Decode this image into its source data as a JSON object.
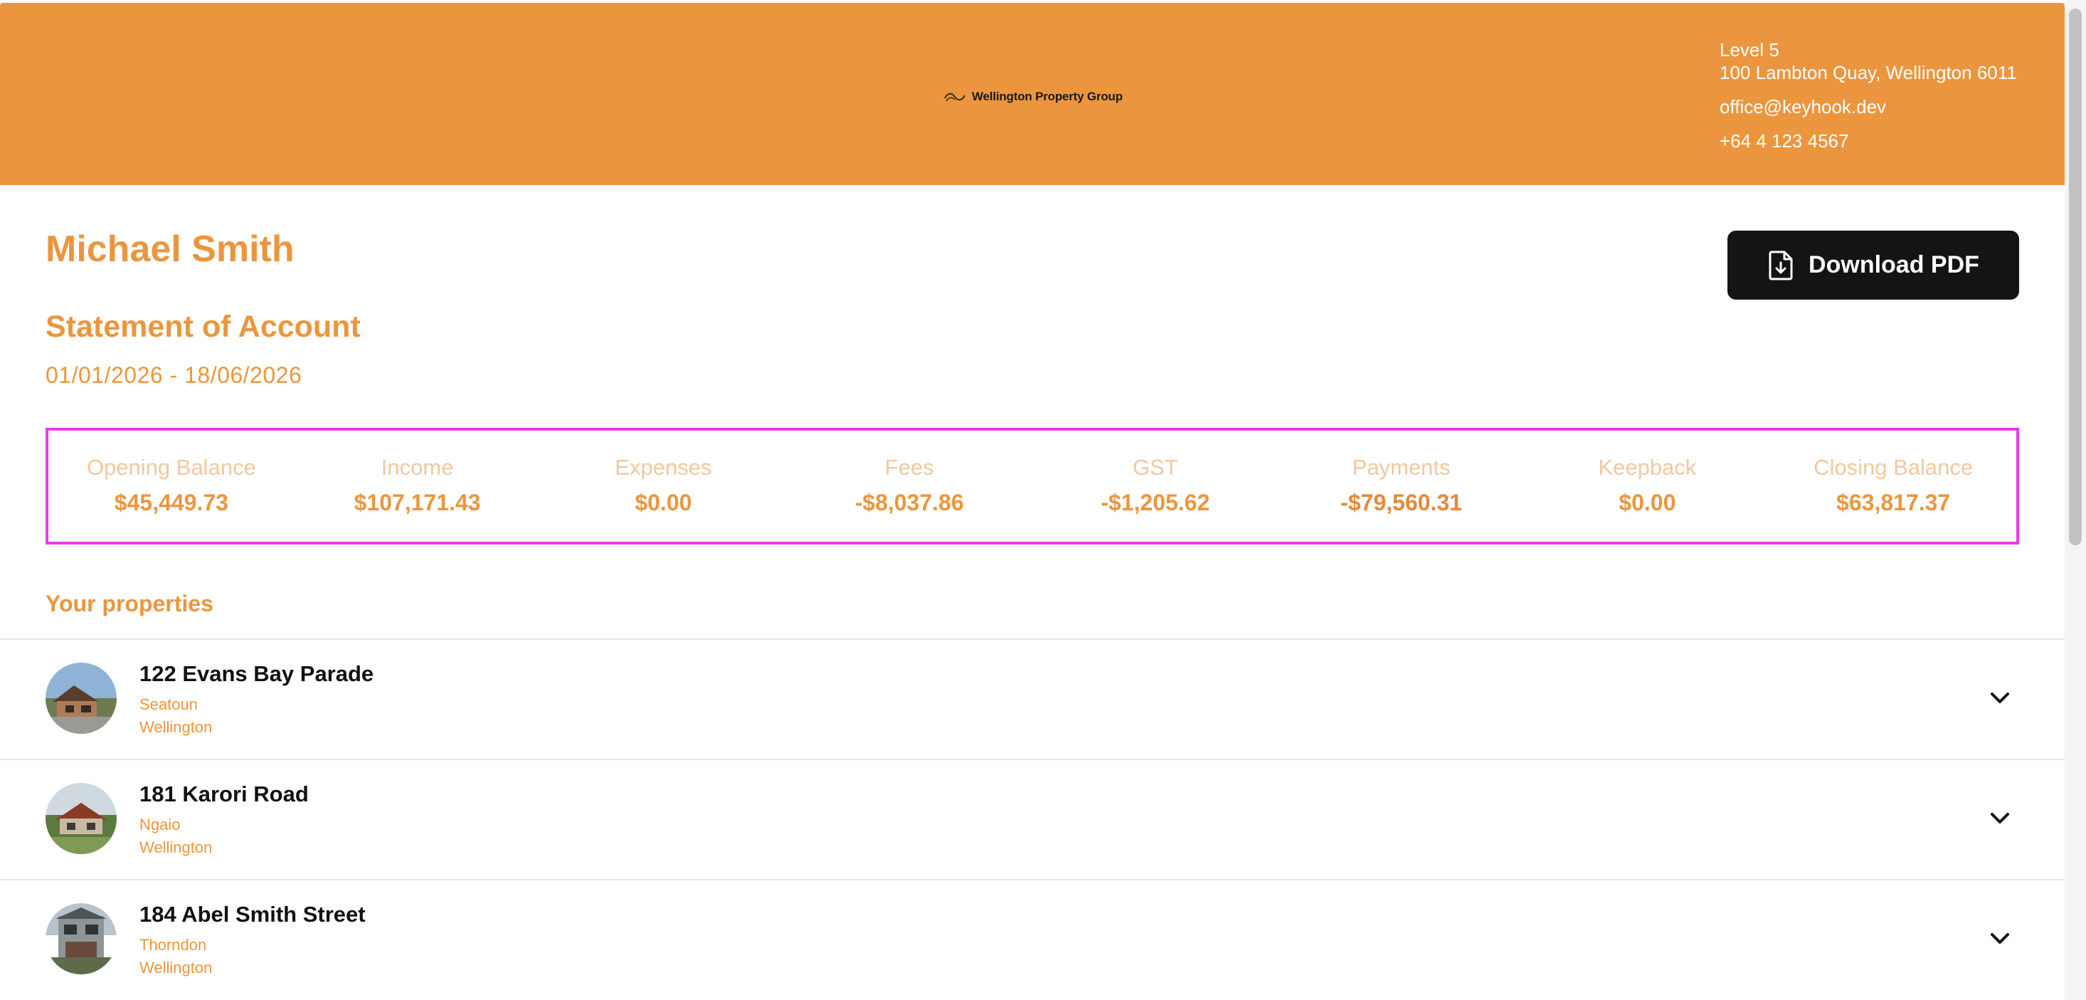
{
  "header": {
    "company": "Wellington Property Group",
    "address_line1": "Level 5",
    "address_line2": "100 Lambton Quay, Wellington 6011",
    "email": "office@keyhook.dev",
    "phone": "+64 4 123 4567",
    "background_color": "#eb963e"
  },
  "statement": {
    "client_name": "Michael Smith",
    "title": "Statement of Account",
    "date_range": "01/01/2026 - 18/06/2026",
    "download_label": "Download PDF"
  },
  "summary": [
    {
      "label": "Opening Balance",
      "value": "$45,449.73"
    },
    {
      "label": "Income",
      "value": "$107,171.43"
    },
    {
      "label": "Expenses",
      "value": "$0.00"
    },
    {
      "label": "Fees",
      "value": "-$8,037.86"
    },
    {
      "label": "GST",
      "value": "-$1,205.62"
    },
    {
      "label": "Payments",
      "value": "-$79,560.31"
    },
    {
      "label": "Keepback",
      "value": "$0.00"
    },
    {
      "label": "Closing Balance",
      "value": "$63,817.37"
    }
  ],
  "properties_title": "Your properties",
  "properties": [
    {
      "address": "122 Evans Bay Parade",
      "suburb": "Seatoun",
      "city": "Wellington",
      "icon": "chevron-down-icon"
    },
    {
      "address": "181 Karori Road",
      "suburb": "Ngaio",
      "city": "Wellington",
      "icon": "chevron-down-icon"
    },
    {
      "address": "184 Abel Smith Street",
      "suburb": "Thorndon",
      "city": "Wellington",
      "icon": "chevron-down-icon"
    }
  ],
  "colors": {
    "accent": "#eb963e",
    "summary_border": "#e93ce5",
    "button": "#141414"
  }
}
